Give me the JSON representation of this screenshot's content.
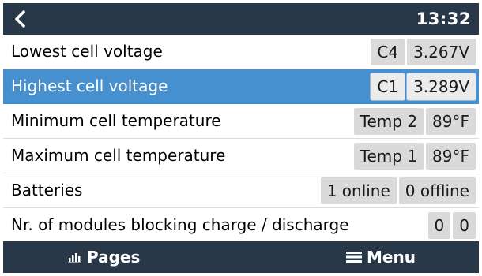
{
  "header": {
    "back_icon": "chevron-left-icon",
    "time": "13:32"
  },
  "rows": [
    {
      "label": "Lowest cell voltage",
      "values": [
        "C4",
        "3.267V"
      ]
    },
    {
      "label": "Highest cell voltage",
      "values": [
        "C1",
        "3.289V"
      ],
      "selected": true
    },
    {
      "label": "Minimum cell temperature",
      "values": [
        "Temp 2",
        "89°F"
      ]
    },
    {
      "label": "Maximum cell temperature",
      "values": [
        "Temp 1",
        "89°F"
      ]
    },
    {
      "label": "Batteries",
      "values": [
        "1 online",
        "0 offline"
      ]
    },
    {
      "label": "Nr. of modules blocking charge / discharge",
      "values": [
        "0",
        "0"
      ]
    }
  ],
  "footer": {
    "pages_label": "Pages",
    "pages_icon": "bar-chart-icon",
    "menu_label": "Menu",
    "menu_icon": "hamburger-menu-icon"
  },
  "colors": {
    "bar_background": "#283849",
    "selection": "#4790d0",
    "value_box": "#dadada"
  }
}
